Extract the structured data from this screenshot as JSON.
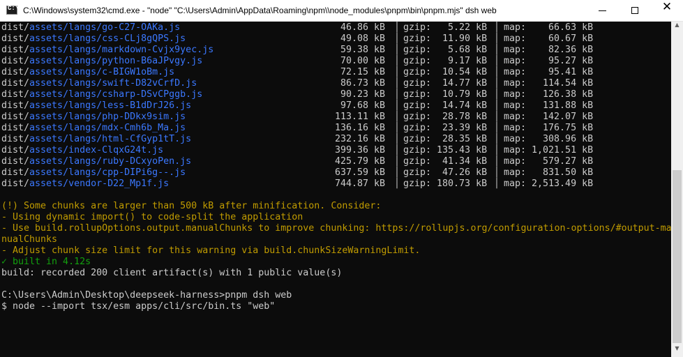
{
  "window": {
    "title": "C:\\Windows\\system32\\cmd.exe  - \"node\"   \"C:\\Users\\Admin\\AppData\\Roaming\\npm\\\\node_modules\\pnpm\\bin\\pnpm.mjs\" dsh web",
    "minimize_label": "",
    "maximize_label": "",
    "close_label": "✕"
  },
  "colors": {
    "background": "#0c0c0c",
    "text": "#cccccc",
    "path_blue": "#3b78ff",
    "warning_yellow": "#c19c00",
    "success_green": "#13a10e"
  },
  "build_rows": [
    {
      "prefix": "dist/",
      "file": "assets/langs/go-C27-OAKa.js",
      "size": "46.86 kB",
      "gzip": "gzip:   5.22 kB",
      "map": "map:    66.63 kB"
    },
    {
      "prefix": "dist/",
      "file": "assets/langs/css-CLj8gQPS.js",
      "size": "49.08 kB",
      "gzip": "gzip:  11.90 kB",
      "map": "map:    60.67 kB"
    },
    {
      "prefix": "dist/",
      "file": "assets/langs/markdown-Cvjx9yec.js",
      "size": "59.38 kB",
      "gzip": "gzip:   5.68 kB",
      "map": "map:    82.36 kB"
    },
    {
      "prefix": "dist/",
      "file": "assets/langs/python-B6aJPvgy.js",
      "size": "70.00 kB",
      "gzip": "gzip:   9.17 kB",
      "map": "map:    95.27 kB"
    },
    {
      "prefix": "dist/",
      "file": "assets/langs/c-BIGW1oBm.js",
      "size": "72.15 kB",
      "gzip": "gzip:  10.54 kB",
      "map": "map:    95.41 kB"
    },
    {
      "prefix": "dist/",
      "file": "assets/langs/swift-D82vCrfD.js",
      "size": "86.73 kB",
      "gzip": "gzip:  14.77 kB",
      "map": "map:   114.54 kB"
    },
    {
      "prefix": "dist/",
      "file": "assets/langs/csharp-DSvCPggb.js",
      "size": "90.23 kB",
      "gzip": "gzip:  10.79 kB",
      "map": "map:   126.38 kB"
    },
    {
      "prefix": "dist/",
      "file": "assets/langs/less-B1dDrJ26.js",
      "size": "97.68 kB",
      "gzip": "gzip:  14.74 kB",
      "map": "map:   131.88 kB"
    },
    {
      "prefix": "dist/",
      "file": "assets/langs/php-DDkx9sim.js",
      "size": "113.11 kB",
      "gzip": "gzip:  28.78 kB",
      "map": "map:   142.07 kB"
    },
    {
      "prefix": "dist/",
      "file": "assets/langs/mdx-Cmh6b_Ma.js",
      "size": "136.16 kB",
      "gzip": "gzip:  23.39 kB",
      "map": "map:   176.75 kB"
    },
    {
      "prefix": "dist/",
      "file": "assets/langs/html-CfGyp1tT.js",
      "size": "232.16 kB",
      "gzip": "gzip:  28.35 kB",
      "map": "map:   308.96 kB"
    },
    {
      "prefix": "dist/",
      "file": "assets/index-ClqxG24t.js",
      "size": "399.36 kB",
      "gzip": "gzip: 135.43 kB",
      "map": "map: 1,021.51 kB"
    },
    {
      "prefix": "dist/",
      "file": "assets/langs/ruby-DCxyoPen.js",
      "size": "425.79 kB",
      "gzip": "gzip:  41.34 kB",
      "map": "map:   579.27 kB"
    },
    {
      "prefix": "dist/",
      "file": "assets/langs/cpp-DIPi6g--.js",
      "size": "637.59 kB",
      "gzip": "gzip:  47.26 kB",
      "map": "map:   831.50 kB"
    },
    {
      "prefix": "dist/",
      "file": "assets/vendor-D22_Mp1f.js",
      "size": "744.87 kB",
      "gzip": "gzip: 180.73 kB",
      "map": "map: 2,513.49 kB"
    }
  ],
  "warning_lines": [
    "(!) Some chunks are larger than 500 kB after minification. Consider:",
    "- Using dynamic import() to code-split the application",
    "- Use build.rollupOptions.output.manualChunks to improve chunking: https://rollupjs.org/configuration-options/#output-ma",
    "nualChunks",
    "- Adjust chunk size limit for this warning via build.chunkSizeWarningLimit."
  ],
  "success_line": "✓ built in 4.12s",
  "recorded_line": "build: recorded 200 client artifact(s) with 1 public value(s)",
  "prompt_line": "C:\\Users\\Admin\\Desktop\\deepseek-harness>pnpm dsh web",
  "exec_line": "$ node --import tsx/esm apps/cli/src/bin.ts \"web\""
}
